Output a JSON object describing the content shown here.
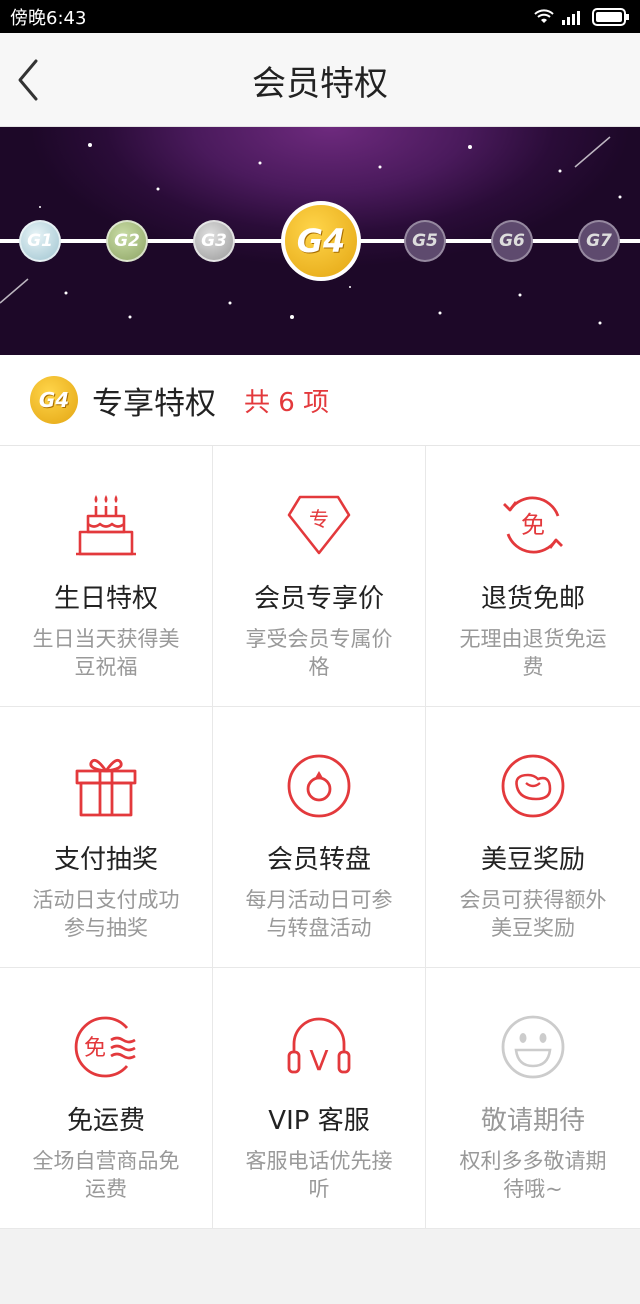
{
  "status_bar": {
    "time": "傍晚6:43"
  },
  "nav": {
    "title": "会员特权"
  },
  "levels": [
    "G1",
    "G2",
    "G3",
    "G4",
    "G5",
    "G6",
    "G7"
  ],
  "current_level_index": 3,
  "privileges": {
    "badge": "G4",
    "title": "专享特权",
    "count_label": "共 6 项"
  },
  "items": [
    {
      "icon": "birthday-cake-icon",
      "title": "生日特权",
      "desc": "生日当天获得美豆祝福"
    },
    {
      "icon": "member-price-diamond-icon",
      "title": "会员专享价",
      "desc": "享受会员专属价格",
      "icon_text": "专"
    },
    {
      "icon": "free-return-icon",
      "title": "退货免邮",
      "desc": "无理由退货免运费",
      "icon_text": "免"
    },
    {
      "icon": "gift-box-icon",
      "title": "支付抽奖",
      "desc": "活动日支付成功参与抽奖"
    },
    {
      "icon": "turntable-icon",
      "title": "会员转盘",
      "desc": "每月活动日可参与转盘活动"
    },
    {
      "icon": "bean-reward-icon",
      "title": "美豆奖励",
      "desc": "会员可获得额外美豆奖励"
    },
    {
      "icon": "free-shipping-icon",
      "title": "免运费",
      "desc": "全场自营商品免运费",
      "icon_text": "免"
    },
    {
      "icon": "vip-headset-icon",
      "title": "VIP 客服",
      "desc": "客服电话优先接听",
      "icon_text": "V"
    },
    {
      "icon": "smiley-face-icon",
      "title": "敬请期待",
      "desc": "权利多多敬请期待哦~"
    }
  ],
  "colors": {
    "accent": "#e3393c",
    "disabled": "#cccccc",
    "gold": "#e3a512"
  }
}
